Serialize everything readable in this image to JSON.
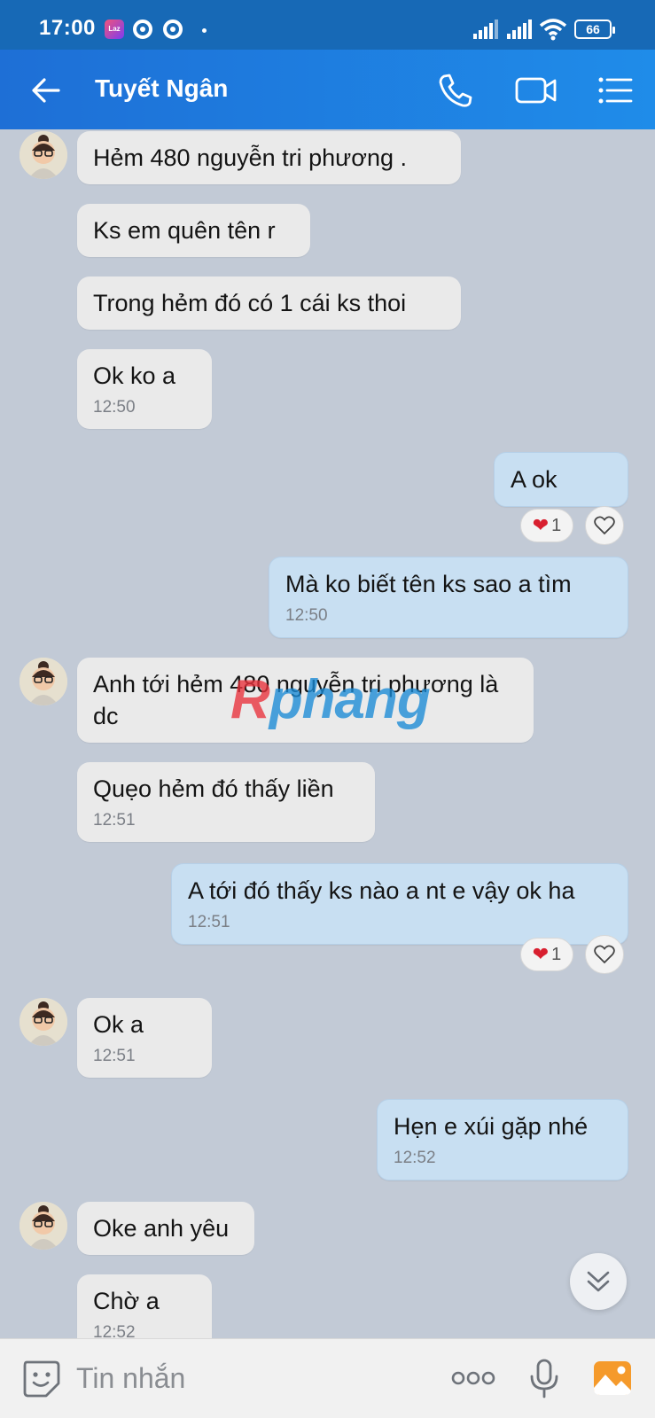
{
  "status_bar": {
    "time": "17:00",
    "app_badge": "Laz",
    "battery": "66"
  },
  "header": {
    "title": "Tuyết Ngân"
  },
  "messages": [
    {
      "text": "Hẻm 480 nguyễn tri phương ."
    },
    {
      "text": "Ks em quên tên r"
    },
    {
      "text": "Trong hẻm đó có 1 cái ks thoi"
    },
    {
      "text": "Ok ko a",
      "time": "12:50"
    },
    {
      "text": "A ok",
      "reaction_count": "1"
    },
    {
      "text": "Mà ko biết tên ks sao a tìm",
      "time": "12:50"
    },
    {
      "text": "Anh tới hẻm 480 nguyễn tri phương là dc"
    },
    {
      "text": "Quẹo hẻm đó thấy liền",
      "time": "12:51"
    },
    {
      "text": "A tới đó thấy ks nào a nt e vậy ok ha",
      "time": "12:51",
      "reaction_count": "1"
    },
    {
      "text": "Ok a",
      "time": "12:51"
    },
    {
      "text": "Hẹn e xúi gặp nhé",
      "time": "12:52"
    },
    {
      "text": "Oke anh yêu"
    },
    {
      "text": "Chờ a",
      "time": "12:52"
    }
  ],
  "watermark": {
    "part1": "R",
    "part2": "phang"
  },
  "composer": {
    "placeholder": "Tin nhắn"
  },
  "colors": {
    "header": "#1e6fd6",
    "outgoing": "#c8dff2",
    "incoming": "#eaeaea",
    "heart": "#d81f2f"
  }
}
